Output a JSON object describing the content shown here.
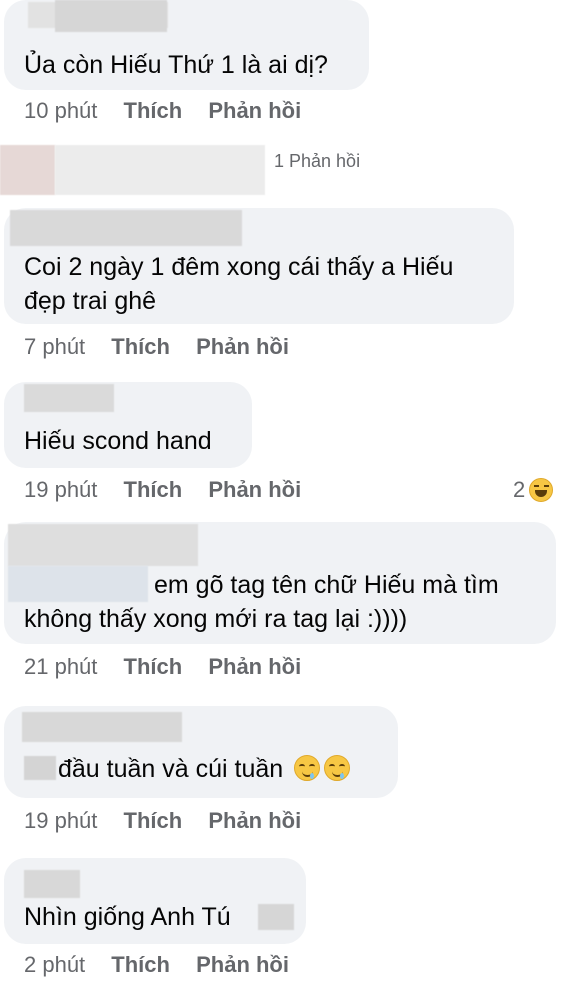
{
  "comments": [
    {
      "text_lines": [
        "Ủa còn Hiếu Thứ 1 là ai dị?"
      ],
      "time": "10 phút",
      "like": "Thích",
      "reply": "Phản hồi"
    },
    {
      "text_lines": [
        "Coi 2 ngày 1 đêm xong cái thấy a Hiếu",
        "đẹp trai ghê"
      ],
      "time": "7 phút",
      "like": "Thích",
      "reply": "Phản hồi"
    },
    {
      "text_lines": [
        "Hiếu scond hand"
      ],
      "time": "19 phút",
      "like": "Thích",
      "reply": "Phản hồi",
      "reaction_count": "2",
      "reaction_icon": "laughing-emoji"
    },
    {
      "text_lines": [
        "em gõ tag tên chữ Hiếu mà tìm",
        "không thấy xong mới ra tag lại :))))"
      ],
      "time": "21 phút",
      "like": "Thích",
      "reply": "Phản hồi"
    },
    {
      "text_lines": [
        "đầu tuần và cúi tuần"
      ],
      "emoji": "drooling-face",
      "time": "19 phút",
      "like": "Thích",
      "reply": "Phản hồi"
    },
    {
      "text_lines": [
        "Nhìn giống Anh Tú"
      ],
      "time": "2 phút",
      "like": "Thích",
      "reply": "Phản hồi"
    }
  ],
  "replies_link": "1 Phản hồi",
  "colors": {
    "bubble": "#f0f2f5",
    "meta": "#65676b",
    "text": "#050505"
  }
}
